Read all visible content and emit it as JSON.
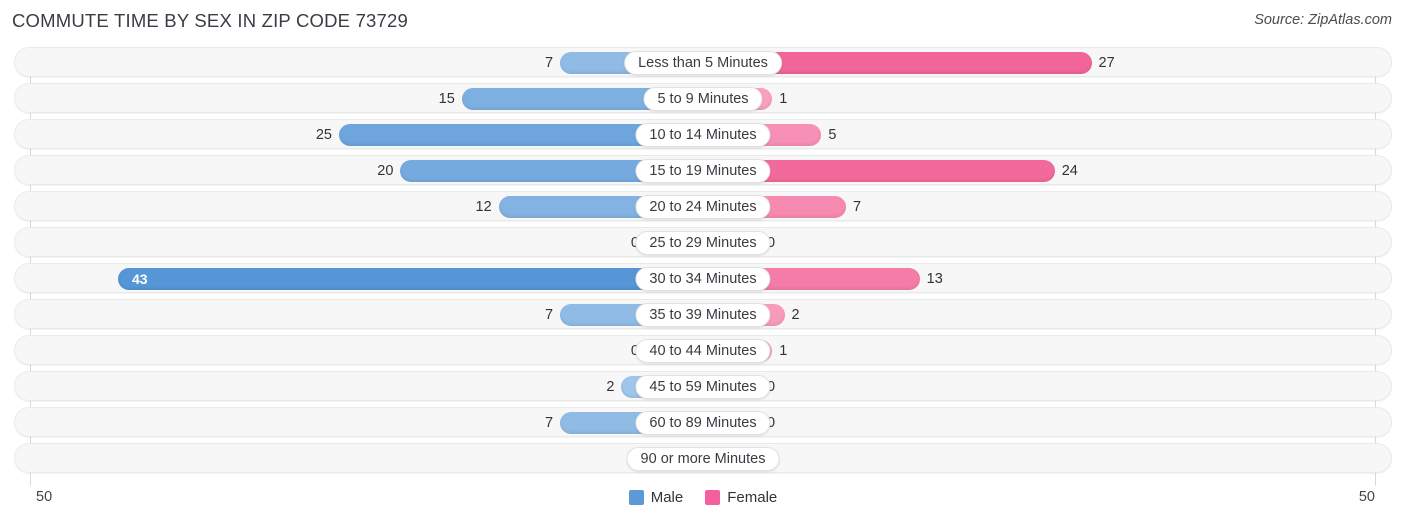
{
  "header": {
    "title": "COMMUTE TIME BY SEX IN ZIP CODE 73729",
    "source": "Source: ZipAtlas.com"
  },
  "axis": {
    "left_tick": "50",
    "right_tick": "50"
  },
  "legend": {
    "items": [
      {
        "label": "Male",
        "color": "#5b9bd5"
      },
      {
        "label": "Female",
        "color": "#f2609e"
      }
    ]
  },
  "chart_data": {
    "type": "bar",
    "orientation": "horizontal-bidirectional",
    "title": "COMMUTE TIME BY SEX IN ZIP CODE 73729",
    "xlabel": "",
    "ylabel": "",
    "xlim": [
      50,
      50
    ],
    "axis_max": 50,
    "grid": false,
    "legend_position": "bottom-center",
    "categories": [
      "Less than 5 Minutes",
      "5 to 9 Minutes",
      "10 to 14 Minutes",
      "15 to 19 Minutes",
      "20 to 24 Minutes",
      "25 to 29 Minutes",
      "30 to 34 Minutes",
      "35 to 39 Minutes",
      "40 to 44 Minutes",
      "45 to 59 Minutes",
      "60 to 89 Minutes",
      "90 or more Minutes"
    ],
    "series": [
      {
        "name": "Male",
        "direction": "left",
        "values": [
          7,
          15,
          25,
          20,
          12,
          0,
          43,
          7,
          0,
          2,
          7,
          0
        ]
      },
      {
        "name": "Female",
        "direction": "right",
        "values": [
          27,
          1,
          5,
          24,
          7,
          0,
          13,
          2,
          1,
          0,
          0,
          0
        ]
      }
    ]
  },
  "rows": [
    {
      "label": "Less than 5 Minutes",
      "male": "7",
      "female": "27"
    },
    {
      "label": "5 to 9 Minutes",
      "male": "15",
      "female": "1"
    },
    {
      "label": "10 to 14 Minutes",
      "male": "25",
      "female": "5"
    },
    {
      "label": "15 to 19 Minutes",
      "male": "20",
      "female": "24"
    },
    {
      "label": "20 to 24 Minutes",
      "male": "12",
      "female": "7"
    },
    {
      "label": "25 to 29 Minutes",
      "male": "0",
      "female": "0"
    },
    {
      "label": "30 to 34 Minutes",
      "male": "43",
      "female": "13"
    },
    {
      "label": "35 to 39 Minutes",
      "male": "7",
      "female": "2"
    },
    {
      "label": "40 to 44 Minutes",
      "male": "0",
      "female": "1"
    },
    {
      "label": "45 to 59 Minutes",
      "male": "2",
      "female": "0"
    },
    {
      "label": "60 to 89 Minutes",
      "male": "7",
      "female": "0"
    },
    {
      "label": "90 or more Minutes",
      "male": "0",
      "female": "0"
    }
  ]
}
